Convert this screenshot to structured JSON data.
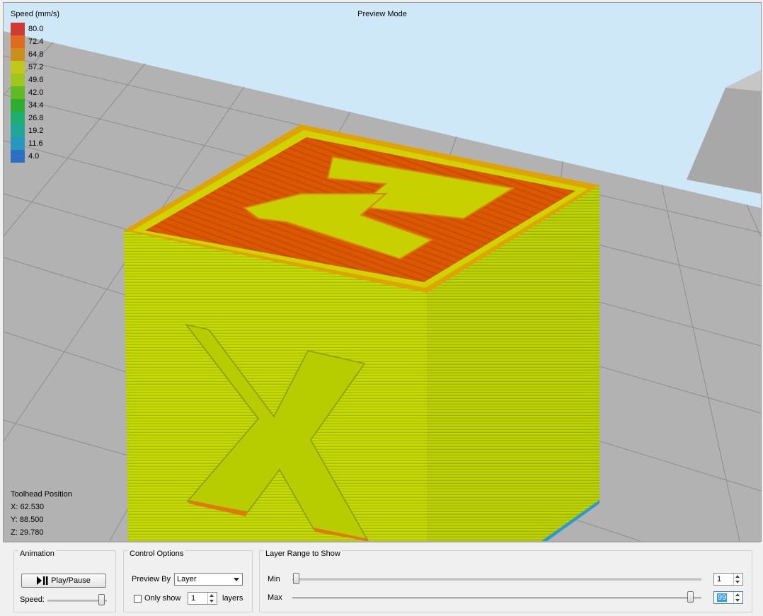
{
  "viewport": {
    "mode_title": "Preview Mode",
    "legend": {
      "title": "Speed (mm/s)",
      "items": [
        {
          "value": "80.0",
          "color": "#d03a33"
        },
        {
          "value": "72.4",
          "color": "#df6b20"
        },
        {
          "value": "64.8",
          "color": "#c9901e"
        },
        {
          "value": "57.2",
          "color": "#c2c71e"
        },
        {
          "value": "49.6",
          "color": "#9fc51e"
        },
        {
          "value": "42.0",
          "color": "#5fba23"
        },
        {
          "value": "34.4",
          "color": "#2fad30"
        },
        {
          "value": "26.8",
          "color": "#1fae72"
        },
        {
          "value": "19.2",
          "color": "#1fa89a"
        },
        {
          "value": "11.6",
          "color": "#2797bd"
        },
        {
          "value": "4.0",
          "color": "#2c6fc5"
        }
      ]
    },
    "toolhead": {
      "title": "Toolhead Position",
      "x": "X: 62.530",
      "y": "Y: 88.500",
      "z": "Z: 29.780"
    },
    "colors": {
      "sky": "#cfe8f8",
      "bed": "#b0b0b0",
      "cube_side": "#c3d800",
      "cube_top": "#dd5a00"
    }
  },
  "panel": {
    "animation": {
      "title": "Animation",
      "play_label": "Play/Pause",
      "speed_label": "Speed:",
      "speed_level": 0.9
    },
    "control": {
      "title": "Control Options",
      "preview_by_label": "Preview By",
      "preview_by_value": "Layer",
      "only_show_label": "Only show",
      "only_show_value": "1",
      "layers_label": "layers"
    },
    "layer_range": {
      "title": "Layer Range to Show",
      "min_label": "Min",
      "min_value": "1",
      "max_label": "Max",
      "max_value": "99"
    }
  }
}
